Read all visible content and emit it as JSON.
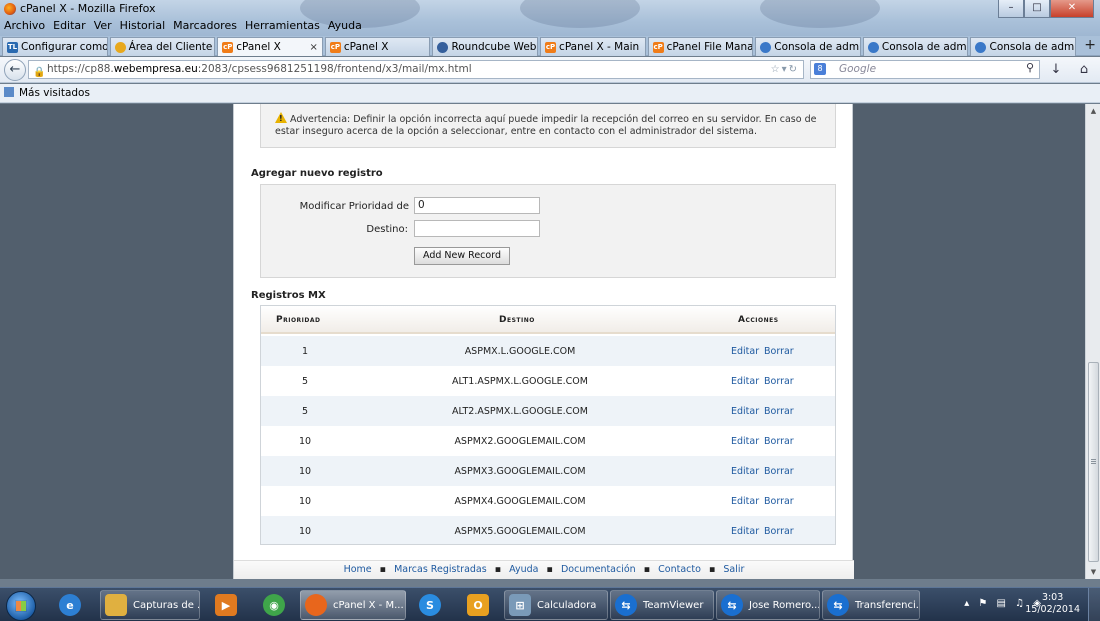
{
  "window": {
    "title": "cPanel X - Mozilla Firefox"
  },
  "menubar": [
    "Archivo",
    "Editar",
    "Ver",
    "Historial",
    "Marcadores",
    "Herramientas",
    "Ayuda"
  ],
  "tabs": [
    {
      "label": "Configurar como ...",
      "icon": "tl-icon",
      "color": "#2a6ab0"
    },
    {
      "label": "Área del Cliente - ...",
      "icon": "client-icon",
      "color": "#e8a81c"
    },
    {
      "label": "cPanel X",
      "icon": "cpanel-icon",
      "color": "#f07c18",
      "active": true,
      "close": "×"
    },
    {
      "label": "cPanel X",
      "icon": "cpanel-icon",
      "color": "#f07c18"
    },
    {
      "label": "Roundcube Web...",
      "icon": "roundcube-icon",
      "color": "#355f9c"
    },
    {
      "label": "cPanel X - Main",
      "icon": "cpanel-icon",
      "color": "#f07c18"
    },
    {
      "label": "cPanel File Manag...",
      "icon": "cpanel-icon",
      "color": "#f07c18"
    },
    {
      "label": "Consola de admin...",
      "icon": "console-icon",
      "color": "#3a78c8"
    },
    {
      "label": "Consola de admin...",
      "icon": "console-icon",
      "color": "#3a78c8"
    },
    {
      "label": "Consola de admin...",
      "icon": "console-icon",
      "color": "#3a78c8"
    }
  ],
  "newtab_label": "+",
  "nav": {
    "url_prefix": "https://cp88.",
    "url_host": "webempresa.eu",
    "url_rest": ":2083/cpsess9681251198/frontend/x3/mail/mx.html",
    "search_placeholder": "Google",
    "search_badge": "8"
  },
  "bookmarks": {
    "label": "Más visitados"
  },
  "warning": {
    "text": "Advertencia: Definir la opción incorrecta aquí puede impedir la recepción del correo en su servidor. En caso de estar inseguro acerca de la opción a seleccionar, entre en contacto con el administrador del sistema."
  },
  "add_record": {
    "heading": "Agregar nuevo registro",
    "priority_label": "Modificar Prioridad de",
    "priority_value": "0",
    "dest_label": "Destino:",
    "dest_value": "",
    "button": "Add New Record"
  },
  "mx": {
    "heading": "Registros MX",
    "columns": {
      "priority": "Prioridad",
      "destination": "Destino",
      "actions": "Acciones"
    },
    "edit_label": "Editar",
    "delete_label": "Borrar",
    "rows": [
      {
        "priority": "1",
        "destination": "ASPMX.L.GOOGLE.COM"
      },
      {
        "priority": "5",
        "destination": "ALT1.ASPMX.L.GOOGLE.COM"
      },
      {
        "priority": "5",
        "destination": "ALT2.ASPMX.L.GOOGLE.COM"
      },
      {
        "priority": "10",
        "destination": "ASPMX2.GOOGLEMAIL.COM"
      },
      {
        "priority": "10",
        "destination": "ASPMX3.GOOGLEMAIL.COM"
      },
      {
        "priority": "10",
        "destination": "ASPMX4.GOOGLEMAIL.COM"
      },
      {
        "priority": "10",
        "destination": "ASPMX5.GOOGLEMAIL.COM"
      }
    ]
  },
  "footer": [
    "Home",
    "Marcas Registradas",
    "Ayuda",
    "Documentación",
    "Contacto",
    "Salir"
  ],
  "taskbar": {
    "items": [
      {
        "label": "",
        "icon": "ie-icon",
        "color": "#2d7fd3",
        "pinned": true
      },
      {
        "label": "Capturas de ...",
        "icon": "folder-icon",
        "color": "#e0b040"
      },
      {
        "label": "",
        "icon": "media-player-icon",
        "color": "#e07a20",
        "pinned": true
      },
      {
        "label": "",
        "icon": "chrome-icon",
        "color": "#3fa54a",
        "pinned": true
      },
      {
        "label": "cPanel X - M...",
        "icon": "firefox-icon",
        "color": "#e8661c",
        "active": true
      },
      {
        "label": "",
        "icon": "skype-icon",
        "color": "#2a8ce0",
        "pinned": true
      },
      {
        "label": "",
        "icon": "outlook-icon",
        "color": "#e8a020",
        "pinned": true
      },
      {
        "label": "Calculadora",
        "icon": "calculator-icon",
        "color": "#7a9ab8"
      },
      {
        "label": "TeamViewer",
        "icon": "teamviewer-icon",
        "color": "#1a6fd0"
      },
      {
        "label": "Jose Romero...",
        "icon": "teamviewer-icon",
        "color": "#1a6fd0"
      },
      {
        "label": "Transferenci...",
        "icon": "teamviewer-icon",
        "color": "#1a6fd0"
      }
    ],
    "time": "3:03",
    "date": "15/02/2014"
  },
  "colors": {
    "link": "#1f5aa0",
    "table_alt_row": "#eef3f8",
    "warning": "#e8b200"
  }
}
